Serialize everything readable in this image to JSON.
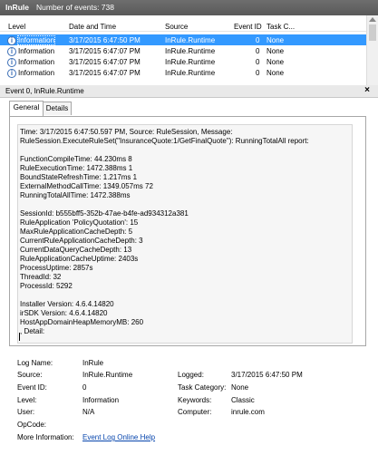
{
  "title_bar": {
    "log_name": "InRule",
    "count_text": "Number of events: 738"
  },
  "columns": [
    "Level",
    "Date and Time",
    "Source",
    "Event ID",
    "Task C..."
  ],
  "rows": [
    {
      "level": "Information",
      "datetime": "3/17/2015 6:47:50 PM",
      "source": "InRule.Runtime",
      "event_id": "0",
      "task": "None",
      "selected": true
    },
    {
      "level": "Information",
      "datetime": "3/17/2015 6:47:07 PM",
      "source": "InRule.Runtime",
      "event_id": "0",
      "task": "None"
    },
    {
      "level": "Information",
      "datetime": "3/17/2015 6:47:07 PM",
      "source": "InRule.Runtime",
      "event_id": "0",
      "task": "None"
    },
    {
      "level": "Information",
      "datetime": "3/17/2015 6:47:07 PM",
      "source": "InRule.Runtime",
      "event_id": "0",
      "task": "None"
    }
  ],
  "detail": {
    "header": "Event 0, InRule.Runtime",
    "close": "×",
    "tabs": [
      "General",
      "Details"
    ],
    "message_lines": [
      "Time: 3/17/2015 6:47:50.597 PM, Source: RuleSession, Message:",
      "RuleSession.ExecuteRuleSet(\"InsuranceQuote:1/GetFinalQuote\"): RunningTotalAll report:",
      "",
      "FunctionCompileTime: 44.230ms 8",
      "RuleExecutionTime: 1472.388ms 1",
      "BoundStateRefreshTime: 1.217ms 1",
      "ExternalMethodCallTime: 1349.057ms 72",
      "RunningTotalAllTime: 1472.388ms",
      "",
      "SessionId: b555bff5-352b-47ae-b4fe-ad934312a381",
      "RuleApplication 'PolicyQuotation': 15",
      "MaxRuleApplicationCacheDepth: 5",
      "CurrentRuleApplicationCacheDepth: 3",
      "CurrentDataQueryCacheDepth: 13",
      "RuleApplicationCacheUptime: 2403s",
      "ProcessUptime: 2857s",
      "ThreadId: 32",
      "ProcessId: 5292",
      "",
      "Installer Version: 4.6.4.14820",
      "irSDK Version: 4.6.4.14820",
      "HostAppDomainHeapMemoryMB: 260",
      ", Detail:"
    ]
  },
  "properties": {
    "log_name_label": "Log Name:",
    "log_name": "InRule",
    "source_label": "Source:",
    "source": "InRule.Runtime",
    "logged_label": "Logged:",
    "logged": "3/17/2015 6:47:50 PM",
    "event_id_label": "Event ID:",
    "event_id": "0",
    "task_label": "Task Category:",
    "task": "None",
    "level_label": "Level:",
    "level": "Information",
    "keywords_label": "Keywords:",
    "keywords": "Classic",
    "user_label": "User:",
    "user": "N/A",
    "computer_label": "Computer:",
    "computer": "inrule.com",
    "opcode_label": "OpCode:",
    "more_info_label": "More Information:",
    "more_info_link": "Event Log Online Help"
  }
}
